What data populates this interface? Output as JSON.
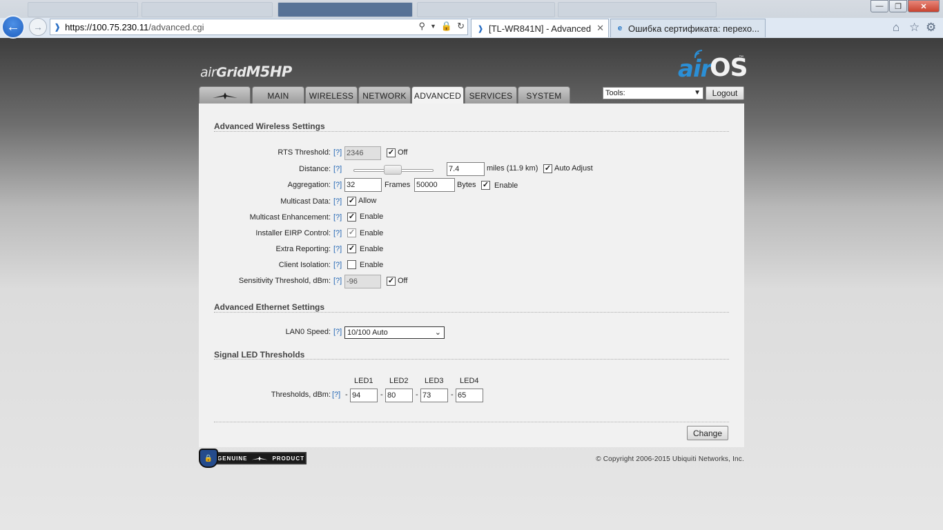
{
  "browser": {
    "url_host": "https://100.75.230.11",
    "url_path": "/advanced.cgi",
    "tabs": [
      {
        "label": "[TL-WR841N] - Advanced"
      },
      {
        "label": "Ошибка сертификата: перехо..."
      }
    ]
  },
  "header": {
    "product_air": "air",
    "product_grid": "Grid",
    "product_model": "M5HP",
    "os_air": "air",
    "os_name": "OS",
    "os_tm": "™"
  },
  "nav": {
    "tabs": [
      "MAIN",
      "WIRELESS",
      "NETWORK",
      "ADVANCED",
      "SERVICES",
      "SYSTEM"
    ],
    "active": "ADVANCED",
    "tools_label": "Tools:",
    "logout_label": "Logout"
  },
  "wireless": {
    "title": "Advanced Wireless Settings",
    "help": "[?]",
    "rts": {
      "label": "RTS Threshold:",
      "value": "2346",
      "off_label": "Off",
      "off_checked": true
    },
    "distance": {
      "label": "Distance:",
      "value": "7.4",
      "units": "miles (11.9 km)",
      "auto_label": "Auto Adjust",
      "auto_checked": true
    },
    "aggregation": {
      "label": "Aggregation:",
      "frames": "32",
      "frames_label": "Frames",
      "bytes": "50000",
      "bytes_label": "Bytes",
      "enable_label": "Enable",
      "enabled": true
    },
    "multicast_data": {
      "label": "Multicast Data:",
      "option": "Allow",
      "checked": true
    },
    "multicast_enh": {
      "label": "Multicast Enhancement:",
      "option": "Enable",
      "checked": true
    },
    "installer_eirp": {
      "label": "Installer EIRP Control:",
      "option": "Enable",
      "checked": true
    },
    "extra_reporting": {
      "label": "Extra Reporting:",
      "option": "Enable",
      "checked": true
    },
    "client_isolation": {
      "label": "Client Isolation:",
      "option": "Enable",
      "checked": false
    },
    "sensitivity": {
      "label": "Sensitivity Threshold, dBm:",
      "value": "-96",
      "off_label": "Off",
      "off_checked": true
    }
  },
  "ethernet": {
    "title": "Advanced Ethernet Settings",
    "lan0": {
      "label": "LAN0 Speed:",
      "value": "10/100 Auto"
    }
  },
  "led": {
    "title": "Signal LED Thresholds",
    "headers": [
      "LED1",
      "LED2",
      "LED3",
      "LED4"
    ],
    "label": "Thresholds, dBm:",
    "minus": "-",
    "values": [
      "94",
      "80",
      "73",
      "65"
    ]
  },
  "actions": {
    "change_label": "Change"
  },
  "footer": {
    "genuine_left": "GENUINE",
    "genuine_right": "PRODUCT",
    "copyright": "© Copyright 2006-2015 Ubiquiti Networks, Inc."
  }
}
